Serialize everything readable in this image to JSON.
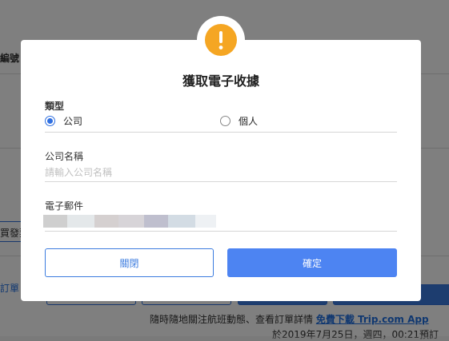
{
  "background": {
    "order_no_label_fragment": "編號",
    "download_label_fragment": "買發票",
    "order_btn_fragment": "訂單",
    "promo_text": "隨時隨地關注航班動態、查看訂單詳情",
    "promo_link": "免費下載 Trip.com App",
    "date_text": "於2019年7月25日，週四，00:21預訂"
  },
  "modal": {
    "title": "獲取電子收據",
    "type_label": "類型",
    "options": [
      {
        "label": "公司",
        "checked": true
      },
      {
        "label": "個人",
        "checked": false
      }
    ],
    "company_label": "公司名稱",
    "company_placeholder": "請輸入公司名稱",
    "company_value": "",
    "email_label": "電子郵件",
    "close_button": "關閉",
    "confirm_button": "確定"
  },
  "colors": {
    "accent": "#4d84f2",
    "alert": "#f5a623",
    "radio": "#2f6fe0"
  },
  "icons": {
    "alert": "exclamation-icon"
  }
}
